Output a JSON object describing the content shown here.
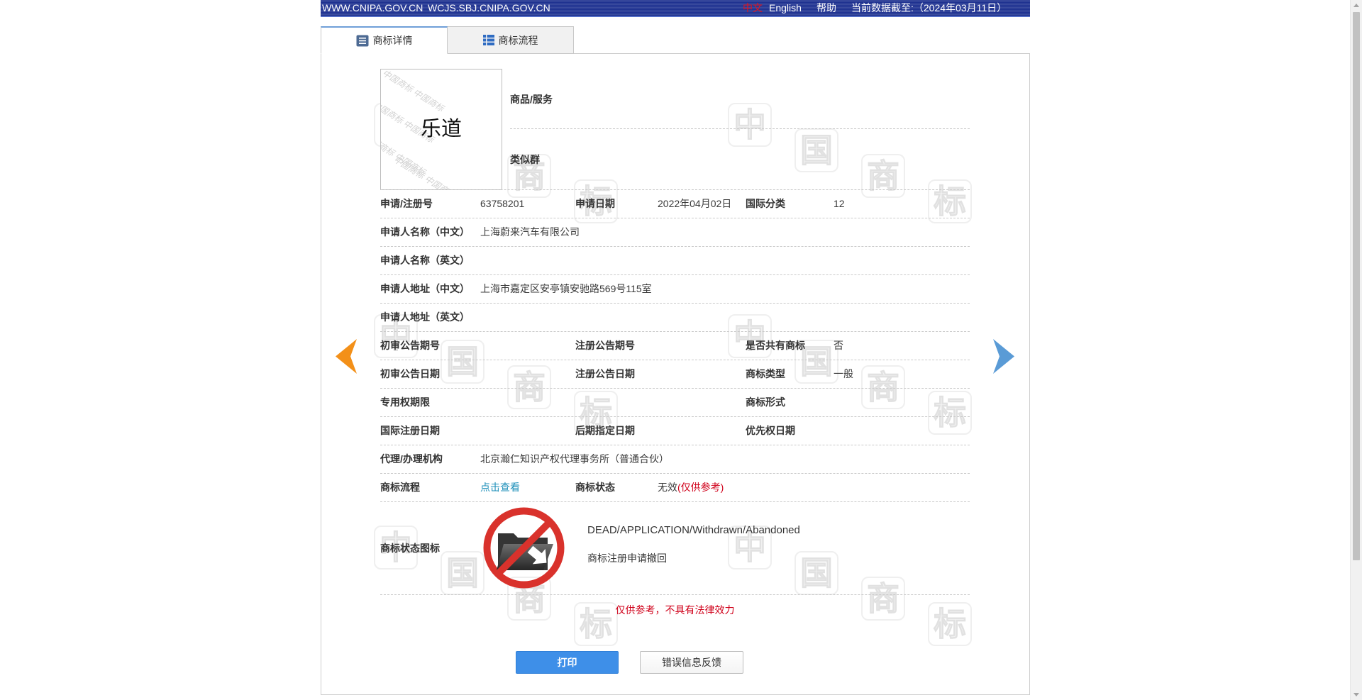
{
  "header": {
    "site_link_1": "WWW.CNIPA.GOV.CN",
    "site_link_2": "WCJS.SBJ.CNIPA.GOV.CN",
    "lang_zh": "中文",
    "lang_en": "English",
    "help": "帮助",
    "data_date": "当前数据截至:（2024年03月11日）"
  },
  "tabs": [
    {
      "label": "商标详情",
      "icon": "list-icon",
      "active": true
    },
    {
      "label": "商标流程",
      "icon": "grid-list-icon",
      "active": false
    }
  ],
  "trademark": {
    "image_text": "乐道",
    "goods_services_label": "商品/服务",
    "similar_group_label": "类似群"
  },
  "details": {
    "reg_no": {
      "label": "申请/注册号",
      "value": "63758201"
    },
    "app_date": {
      "label": "申请日期",
      "value": "2022年04月02日"
    },
    "intl_class": {
      "label": "国际分类",
      "value": "12"
    },
    "applicant_cn": {
      "label": "申请人名称（中文）",
      "value": "上海蔚来汽车有限公司"
    },
    "applicant_en": {
      "label": "申请人名称（英文）"
    },
    "address_cn": {
      "label": "申请人地址（中文）",
      "value": "上海市嘉定区安亭镇安驰路569号115室"
    },
    "address_en": {
      "label": "申请人地址（英文）"
    },
    "prelim_pub_no": {
      "label": "初审公告期号"
    },
    "reg_pub_no": {
      "label": "注册公告期号"
    },
    "shared": {
      "label": "是否共有商标",
      "value": "否"
    },
    "prelim_pub_date": {
      "label": "初审公告日期"
    },
    "reg_pub_date": {
      "label": "注册公告日期"
    },
    "tm_type": {
      "label": "商标类型",
      "value": "一般"
    },
    "exclusive_term": {
      "label": "专用权期限"
    },
    "tm_form": {
      "label": "商标形式"
    },
    "intl_reg_date": {
      "label": "国际注册日期"
    },
    "later_designation_date": {
      "label": "后期指定日期"
    },
    "priority_date": {
      "label": "优先权日期"
    },
    "agent": {
      "label": "代理/办理机构",
      "value": "北京瀚仁知识产权代理事务所（普通合伙）"
    },
    "process": {
      "label": "商标流程",
      "link": "点击查看"
    },
    "status": {
      "label": "商标状态",
      "value": "无效",
      "note": "(仅供参考)"
    }
  },
  "status_icon": {
    "label": "商标状态图标",
    "icon": "folder-prohibited-icon",
    "status_en": "DEAD/APPLICATION/Withdrawn/Abandoned",
    "status_cn": "商标注册申请撤回"
  },
  "disclaimer": "仅供参考，不具有法律效力",
  "buttons": {
    "print": "打印",
    "feedback": "错误信息反馈"
  },
  "nav": {
    "prev_icon": "prev-arrow-icon",
    "next_icon": "next-arrow-icon"
  },
  "watermark": {
    "chars": [
      "中",
      "国",
      "商",
      "标"
    ]
  },
  "colors": {
    "header_bg": "#1e3190",
    "lang_active": "#e4141b",
    "link": "#1c8fb9",
    "warning_red": "#d0021b",
    "print_button": "#3e8fe8",
    "prev_arrow": "#f39019",
    "next_arrow": "#5a9bd6",
    "status_mark": "#d9322c"
  }
}
